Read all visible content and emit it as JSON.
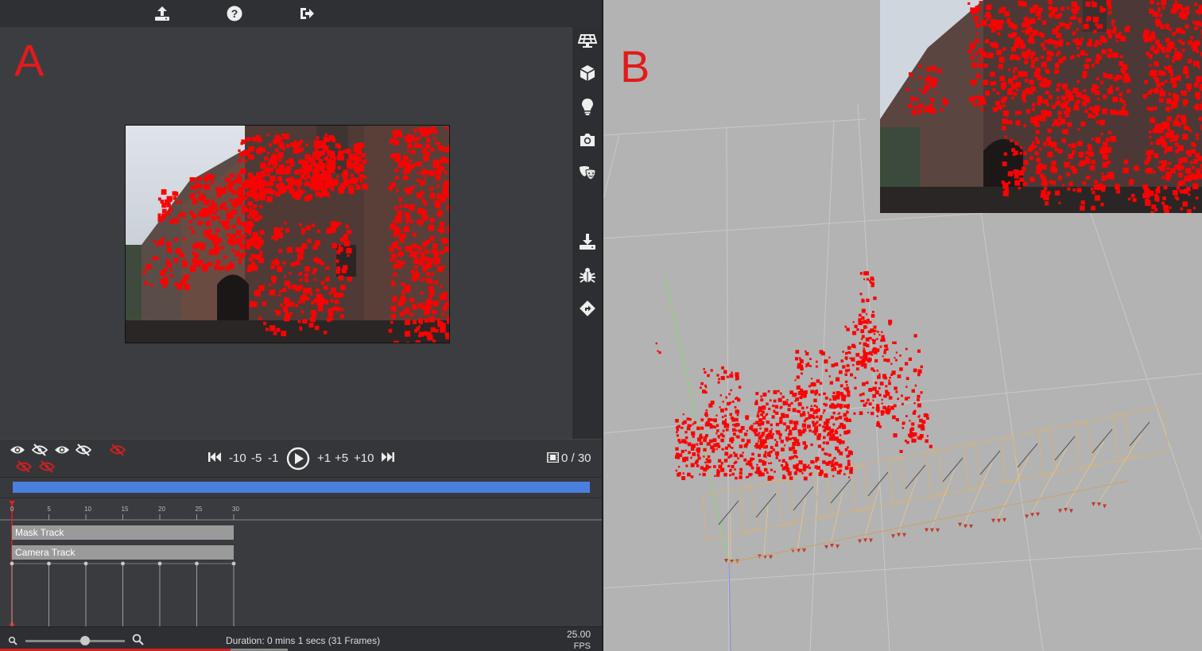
{
  "panels": {
    "left_label": "A",
    "right_label": "B"
  },
  "toolbar": {
    "icons": [
      "upload-icon",
      "help-icon",
      "logout-icon"
    ]
  },
  "sidebar": {
    "icons": [
      "grid-icon",
      "cube-icon",
      "lightbulb-icon",
      "camera-icon",
      "masks-icon",
      "download-icon",
      "bug-icon",
      "route-icon"
    ]
  },
  "playback": {
    "step_back": [
      "-10",
      "-5",
      "-1"
    ],
    "step_forward": [
      "+1",
      "+5",
      "+10"
    ],
    "frame_counter": "0 / 30"
  },
  "timeline": {
    "ticks": [
      "0",
      "5",
      "10",
      "15",
      "20",
      "25",
      "30"
    ],
    "tracks": [
      {
        "label": "Mask Track"
      },
      {
        "label": "Camera Track"
      }
    ],
    "progress_percent": 100
  },
  "footer": {
    "duration": "Duration: 0 mins 1 secs (31 Frames)",
    "fps_value": "25.00",
    "fps_unit": "FPS",
    "zoom_fraction": 0.6
  },
  "colors": {
    "accent": "#4a7fe0",
    "feature_points": "#ff0000",
    "label_red": "#e31a1a"
  }
}
